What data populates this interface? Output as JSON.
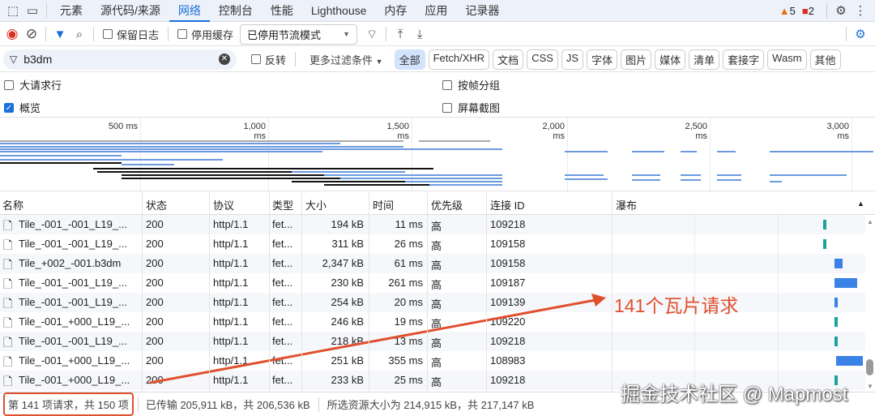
{
  "tabs": {
    "items": [
      "元素",
      "源代码/来源",
      "网络",
      "控制台",
      "性能",
      "Lighthouse",
      "内存",
      "应用",
      "记录器"
    ],
    "active": "网络",
    "warnings": "5",
    "errors": "2"
  },
  "toolbar": {
    "preserve_log": "保留日志",
    "disable_cache": "停用缓存",
    "throttle": "已停用节流模式"
  },
  "filter": {
    "value": "b3dm",
    "invert": "反转",
    "more": "更多过滤条件",
    "chips": [
      "全部",
      "Fetch/XHR",
      "文档",
      "CSS",
      "JS",
      "字体",
      "图片",
      "媒体",
      "清单",
      "套接字",
      "Wasm",
      "其他"
    ]
  },
  "options": {
    "big_rows": "大请求行",
    "group_by_frame": "按帧分组",
    "overview": "概览",
    "screenshots": "屏幕截图",
    "overview_checked": true
  },
  "overview_ticks": [
    "500 ms",
    "1,000 ms",
    "1,500 ms",
    "2,000 ms",
    "2,500 ms",
    "3,000 ms"
  ],
  "columns": [
    "名称",
    "状态",
    "协议",
    "类型",
    "大小",
    "时间",
    "优先级",
    "连接 ID",
    "瀑布"
  ],
  "rows": [
    [
      "Tile_-001_-001_L19_...",
      "200",
      "http/1.1",
      "fet...",
      "194 kB",
      "11 ms",
      "高",
      "109218"
    ],
    [
      "Tile_-001_-001_L19_...",
      "200",
      "http/1.1",
      "fet...",
      "311 kB",
      "26 ms",
      "高",
      "109158"
    ],
    [
      "Tile_+002_-001.b3dm",
      "200",
      "http/1.1",
      "fet...",
      "2,347 kB",
      "61 ms",
      "高",
      "109158"
    ],
    [
      "Tile_-001_-001_L19_...",
      "200",
      "http/1.1",
      "fet...",
      "230 kB",
      "261 ms",
      "高",
      "109187"
    ],
    [
      "Tile_-001_-001_L19_...",
      "200",
      "http/1.1",
      "fet...",
      "254 kB",
      "20 ms",
      "高",
      "109139"
    ],
    [
      "Tile_-001_+000_L19_...",
      "200",
      "http/1.1",
      "fet...",
      "246 kB",
      "19 ms",
      "高",
      "109220"
    ],
    [
      "Tile_-001_-001_L19_...",
      "200",
      "http/1.1",
      "fet...",
      "218 kB",
      "13 ms",
      "高",
      "109218"
    ],
    [
      "Tile_-001_+000_L19_...",
      "200",
      "http/1.1",
      "fet...",
      "251 kB",
      "355 ms",
      "高",
      "108983"
    ],
    [
      "Tile_-001_+000_L19_...",
      "200",
      "http/1.1",
      "fet...",
      "233 kB",
      "25 ms",
      "高",
      "109218"
    ]
  ],
  "footer": {
    "requests": "第 141 项请求，共 150 项",
    "transferred": "已传输 205,911 kB，共 206,536 kB",
    "resources": "所选资源大小为 214,915 kB，共 217,147 kB"
  },
  "annotation": {
    "label": "141个瓦片请求",
    "color": "#e0502d"
  },
  "watermark": "掘金技术社区 @ Mapmost"
}
